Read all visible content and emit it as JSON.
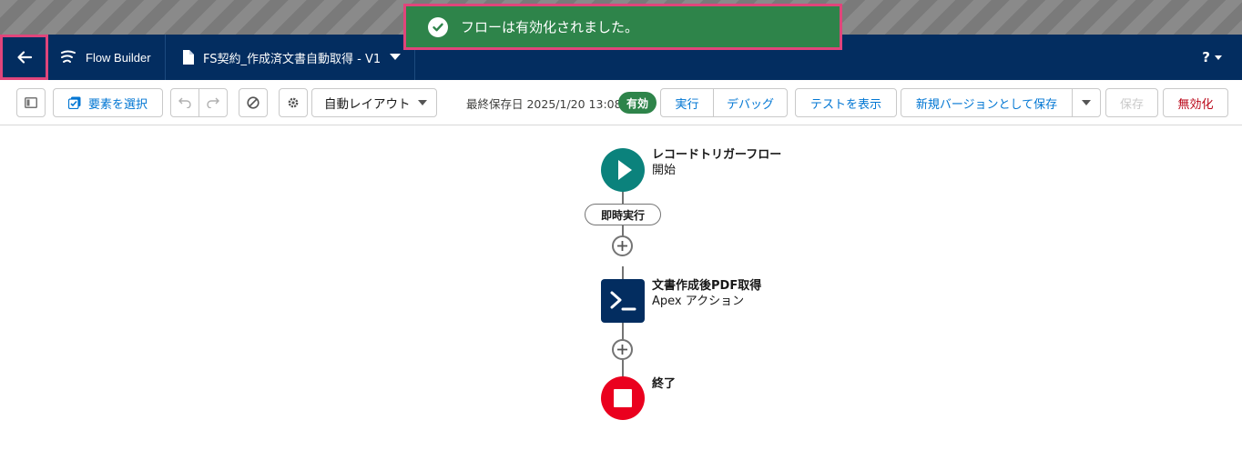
{
  "toast": {
    "message": "フローは有効化されました。",
    "color": "#2e844a"
  },
  "header": {
    "back_icon": "arrow-left-icon",
    "brand": "Flow Builder",
    "flow_name": "FS契約_作成済文書自動取得 - V1",
    "help": "?",
    "bg_color": "#032d60"
  },
  "toolbar": {
    "select_elements": "要素を選択",
    "layout_mode": "自動レイアウト",
    "last_saved_label": "最終保存日 2025/1/20 13:08",
    "status": "有効",
    "run": "実行",
    "debug": "デバッグ",
    "view_tests": "テストを表示",
    "save_as_new_version": "新規バージョンとして保存",
    "save": "保存",
    "deactivate": "無効化"
  },
  "canvas": {
    "start_node": {
      "title": "レコードトリガーフロー",
      "subtitle": "開始",
      "color": "#0b827c"
    },
    "path_label": "即時実行",
    "action_node": {
      "title": "文書作成後PDF取得",
      "subtitle": "Apex アクション",
      "color": "#032d60"
    },
    "end_node": {
      "title": "終了",
      "color": "#ea001e"
    }
  }
}
